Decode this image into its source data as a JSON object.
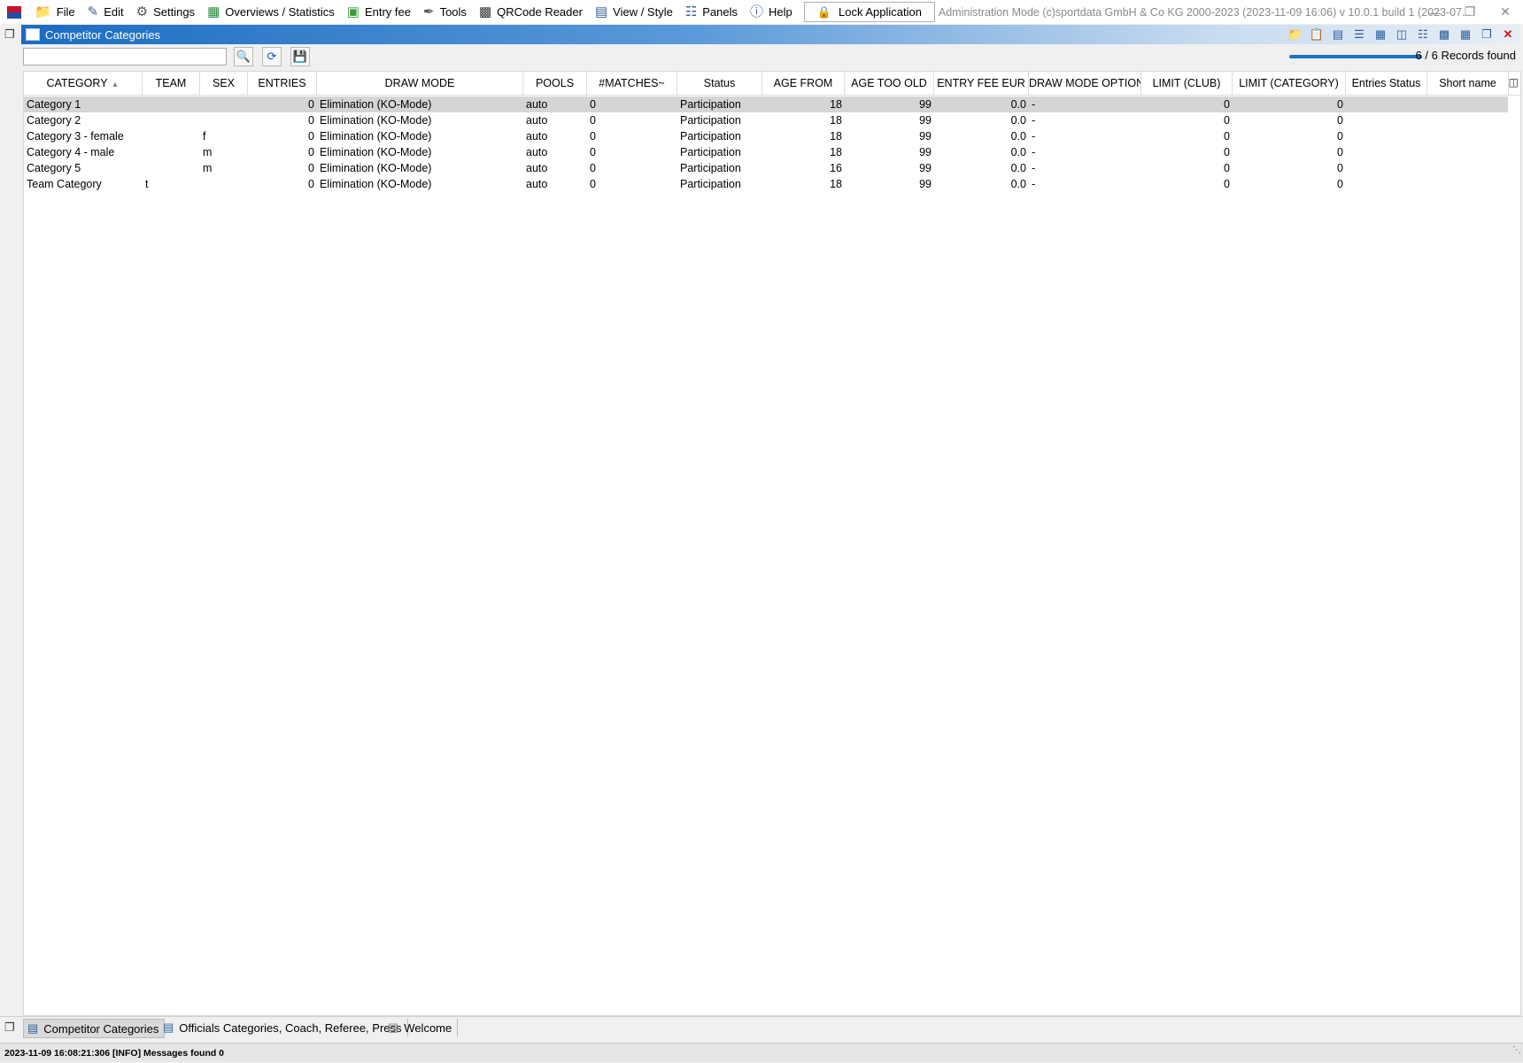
{
  "menubar": {
    "items": [
      {
        "label": "File",
        "icon": "folder-icon"
      },
      {
        "label": "Edit",
        "icon": "edit-icon"
      },
      {
        "label": "Settings",
        "icon": "gear-icon"
      },
      {
        "label": "Overviews / Statistics",
        "icon": "statistics-icon"
      },
      {
        "label": "Entry fee",
        "icon": "money-icon"
      },
      {
        "label": "Tools",
        "icon": "wrench-icon"
      },
      {
        "label": "QRCode Reader",
        "icon": "qrcode-icon"
      },
      {
        "label": "View / Style",
        "icon": "view-icon"
      },
      {
        "label": "Panels",
        "icon": "panels-icon"
      },
      {
        "label": "Help",
        "icon": "help-icon"
      }
    ],
    "lock_label": "Lock Application",
    "admin_text": "Administration Mode (c)sportdata GmbH & Co KG 2000-2023 (2023-11-09 16:06)  v 10.0.1 build 1 (2023-07..."
  },
  "panel": {
    "title": "Competitor Categories",
    "search": {
      "value": "",
      "placeholder": ""
    },
    "records_text": "6 / 6 Records found",
    "progress": 1.0
  },
  "grid": {
    "columns": [
      {
        "key": "category",
        "label": "CATEGORY",
        "sorted": "asc"
      },
      {
        "key": "team",
        "label": "TEAM"
      },
      {
        "key": "sex",
        "label": "SEX"
      },
      {
        "key": "entries",
        "label": "ENTRIES"
      },
      {
        "key": "draw_mode",
        "label": "DRAW MODE"
      },
      {
        "key": "pools",
        "label": "POOLS"
      },
      {
        "key": "matches",
        "label": "#MATCHES~"
      },
      {
        "key": "status",
        "label": "Status"
      },
      {
        "key": "age_from",
        "label": "AGE FROM"
      },
      {
        "key": "age_too_old",
        "label": "AGE TOO OLD"
      },
      {
        "key": "entry_fee",
        "label": "ENTRY FEE EUR"
      },
      {
        "key": "draw_mode_option",
        "label": "DRAW MODE OPTION"
      },
      {
        "key": "limit_club",
        "label": "LIMIT (CLUB)"
      },
      {
        "key": "limit_category",
        "label": "LIMIT (CATEGORY)"
      },
      {
        "key": "entries_status",
        "label": "Entries Status"
      },
      {
        "key": "short_name",
        "label": "Short name"
      }
    ],
    "rows": [
      {
        "category": "Category 1",
        "team": "",
        "sex": "",
        "entries": "0",
        "draw_mode": "Elimination (KO-Mode)",
        "pools": "auto",
        "matches": "0",
        "status": "Participation",
        "age_from": "18",
        "age_too_old": "99",
        "entry_fee": "0.0",
        "draw_mode_option": "-",
        "limit_club": "0",
        "limit_category": "0",
        "entries_status": "",
        "short_name": ""
      },
      {
        "category": "Category 2",
        "team": "",
        "sex": "",
        "entries": "0",
        "draw_mode": "Elimination (KO-Mode)",
        "pools": "auto",
        "matches": "0",
        "status": "Participation",
        "age_from": "18",
        "age_too_old": "99",
        "entry_fee": "0.0",
        "draw_mode_option": "-",
        "limit_club": "0",
        "limit_category": "0",
        "entries_status": "",
        "short_name": ""
      },
      {
        "category": "Category 3 - female",
        "team": "",
        "sex": "f",
        "entries": "0",
        "draw_mode": "Elimination (KO-Mode)",
        "pools": "auto",
        "matches": "0",
        "status": "Participation",
        "age_from": "18",
        "age_too_old": "99",
        "entry_fee": "0.0",
        "draw_mode_option": "-",
        "limit_club": "0",
        "limit_category": "0",
        "entries_status": "",
        "short_name": ""
      },
      {
        "category": "Category 4 - male",
        "team": "",
        "sex": "m",
        "entries": "0",
        "draw_mode": "Elimination (KO-Mode)",
        "pools": "auto",
        "matches": "0",
        "status": "Participation",
        "age_from": "18",
        "age_too_old": "99",
        "entry_fee": "0.0",
        "draw_mode_option": "-",
        "limit_club": "0",
        "limit_category": "0",
        "entries_status": "",
        "short_name": ""
      },
      {
        "category": "Category 5",
        "team": "",
        "sex": "m",
        "entries": "0",
        "draw_mode": "Elimination (KO-Mode)",
        "pools": "auto",
        "matches": "0",
        "status": "Participation",
        "age_from": "16",
        "age_too_old": "99",
        "entry_fee": "0.0",
        "draw_mode_option": "-",
        "limit_club": "0",
        "limit_category": "0",
        "entries_status": "",
        "short_name": ""
      },
      {
        "category": "Team Category",
        "team": "t",
        "sex": "",
        "entries": "0",
        "draw_mode": "Elimination (KO-Mode)",
        "pools": "auto",
        "matches": "0",
        "status": "Participation",
        "age_from": "18",
        "age_too_old": "99",
        "entry_fee": "0.0",
        "draw_mode_option": "-",
        "limit_club": "0",
        "limit_category": "0",
        "entries_status": "",
        "short_name": ""
      }
    ],
    "selected_row": 0
  },
  "tabs": [
    {
      "label": "Competitor Categories",
      "active": true
    },
    {
      "label": "Officials Categories, Coach, Referee, Press",
      "active": false
    },
    {
      "label": "Welcome",
      "active": false
    }
  ],
  "status_text": "2023-11-09 16:08:21:306 [INFO] Messages found 0"
}
